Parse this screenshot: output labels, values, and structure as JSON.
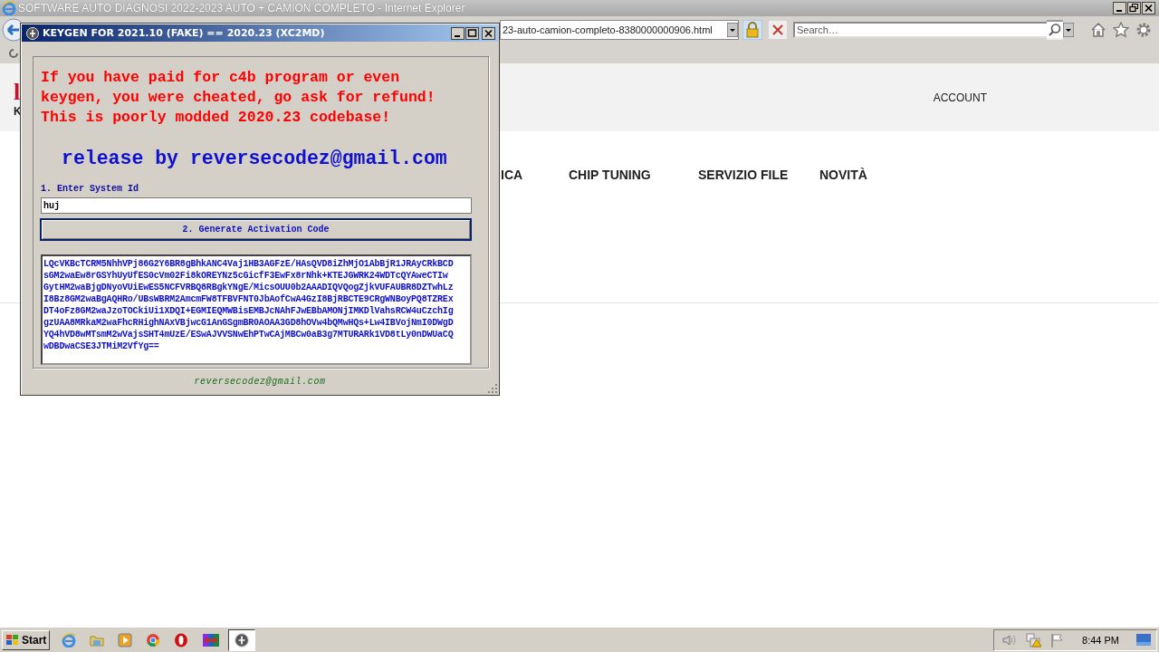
{
  "browser": {
    "title": "SOFTWARE AUTO DIAGNOSI 2022-2023 AUTO + CAMION COMPLETO - Internet Explorer",
    "address": "23-auto-camion-completo-8380000000906.html",
    "search": {
      "placeholder": "Search…"
    },
    "page": {
      "logo_fragments": [
        "l",
        "K"
      ],
      "account": "ACCOUNT",
      "nav": [
        "ICA",
        "CHIP TUNING",
        "SERVIZIO FILE",
        "NOVITÀ"
      ]
    }
  },
  "keygen": {
    "title": "KEYGEN FOR 2021.10 (FAKE) == 2020.23 (XC2MD)",
    "warning": [
      "If you have paid for c4b program or even",
      "keygen, you were cheated, go ask for refund!",
      "This is poorly modded 2020.23 codebase!"
    ],
    "release": "release by reversecodez@gmail.com",
    "system_id": {
      "label": "1. Enter System Id",
      "value": "huj"
    },
    "generate_button": "2. Generate Activation Code",
    "activation_code": [
      "LQcVKBcTCRM5NhhVPj86G2Y6BR8gBhkANC4Vaj1HB3AGFzE/HAsQVD8iZhMjO1AbBjR1JRAyCRkBCD",
      "sGM2waEw8rGSYhUyUfES0cVm02Fi8kOREYNz5cGicfF3EwFx8rNhk+KTEJGWRK24WDTcQYAweCTIw",
      "GytHM2waBjgDNyoVUiEwES5NCFVRBQ8RBgkYNgE/MicsOUU0b2AAADIQVQogZjkVUFAUBR8DZTwhLz",
      "I8Bz8GM2waBgAQHRo/UBsWBRM2AmcmFW8TFBVFNT0JbAofCwA4GzI8BjRBCTE9CRgWNBoyPQ8TZREx",
      "DT4oFz8GM2waJzoTOCkiUi1XDQI+EGMIEQMWBisEMBJcNAhFJwEBbAMONjIMKDlVahsRCW4uCzchIg",
      "gzUAA8MRkaM2waFhcRHighNAxVBjwcG1AnGSgmBR0AOAA3GD8hOVw4bQMwHQs+Lw4IBVojNmI0DWgD",
      "YQ4hVD8wMTsmM2wVajsSHT4mUzE/ESwAJVVSNwEhPTwCAjMBCw0aB3g7MTURARk1VD8tLy0nDWUaCQ",
      "wDBDwaCSE3JTMiM2VfYg=="
    ],
    "status": "reversecodez@gmail.com"
  },
  "taskbar": {
    "start": "Start",
    "clock": "8:44 PM"
  }
}
